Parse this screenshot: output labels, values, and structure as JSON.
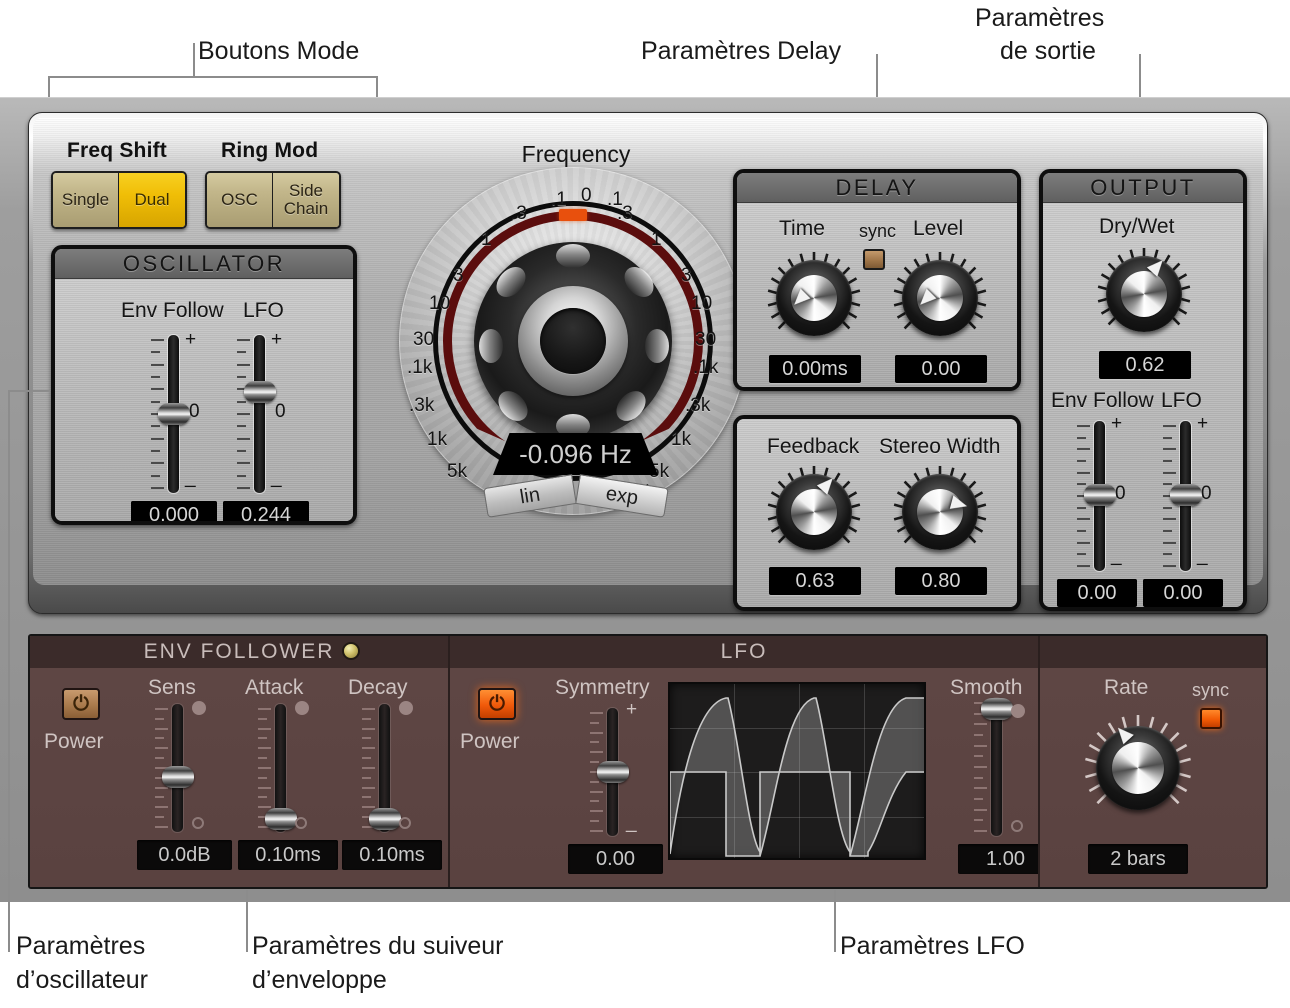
{
  "annotations": {
    "mode_buttons": "Boutons Mode",
    "delay_params": "Paramètres Delay",
    "output_params_l1": "Paramètres",
    "output_params_l2": "de sortie",
    "oscillator_params_l1": "Paramètres",
    "oscillator_params_l2": "d’oscillateur",
    "env_follower_params_l1": "Paramètres du suiveur",
    "env_follower_params_l2": "d’enveloppe",
    "lfo_params": "Paramètres LFO"
  },
  "mode": {
    "freq_shift_label": "Freq Shift",
    "ring_mod_label": "Ring Mod",
    "buttons": [
      {
        "label": "Single",
        "active": false
      },
      {
        "label": "Dual",
        "active": true
      },
      {
        "label": "OSC",
        "active": false
      },
      {
        "label": "Side\nChain",
        "active": false
      }
    ],
    "side_chain_l1": "Side",
    "side_chain_l2": "Chain"
  },
  "oscillator": {
    "title": "OSCILLATOR",
    "env_follow_label": "Env Follow",
    "lfo_label": "LFO",
    "env_follow_value": "0.000",
    "lfo_value": "0.244",
    "plus": "+",
    "minus": "_",
    "zero": "0"
  },
  "frequency": {
    "title": "Frequency",
    "readout": "-0.096 Hz",
    "lin_label": "lin",
    "exp_label": "exp",
    "minus": "–",
    "plus": "+",
    "scale_left": [
      ".3",
      "1",
      "3",
      "10",
      "30",
      ".1k",
      ".3k",
      "1k",
      "5k"
    ],
    "scale_right": [
      ".3",
      "1",
      "3",
      "10",
      "30",
      ".1k",
      ".3k",
      "1k",
      "5k"
    ],
    "scale_top": [
      ".1",
      "0",
      ".1"
    ]
  },
  "delay": {
    "title": "DELAY",
    "time_label": "Time",
    "sync_label": "sync",
    "sync_on": false,
    "level_label": "Level",
    "time_value": "0.00ms",
    "level_value": "0.00",
    "feedback_label": "Feedback",
    "stereo_width_label": "Stereo Width",
    "feedback_value": "0.63",
    "stereo_width_value": "0.80"
  },
  "output": {
    "title": "OUTPUT",
    "dry_wet_label": "Dry/Wet",
    "dry_wet_value": "0.62",
    "env_follow_label": "Env Follow",
    "lfo_label": "LFO",
    "env_follow_value": "0.00",
    "lfo_value": "0.00",
    "plus": "+",
    "minus": "_",
    "zero": "0"
  },
  "env_follower": {
    "title": "ENV FOLLOWER",
    "power_label": "Power",
    "power_on": false,
    "sens_label": "Sens",
    "attack_label": "Attack",
    "decay_label": "Decay",
    "sens_value": "0.0dB",
    "attack_value": "0.10ms",
    "decay_value": "0.10ms"
  },
  "lfo": {
    "title": "LFO",
    "power_label": "Power",
    "power_on": true,
    "symmetry_label": "Symmetry",
    "symmetry_value": "0.00",
    "smooth_label": "Smooth",
    "smooth_value": "1.00",
    "rate_label": "Rate",
    "sync_label": "sync",
    "sync_on": true,
    "rate_value": "2 bars",
    "plus": "+",
    "minus": "_"
  },
  "colors": {
    "accent_yellow": "#f0be07",
    "accent_orange": "#f0590a",
    "panel_brown": "#5a4240",
    "metal_grey": "#b4b4b4",
    "readout_black": "#000000"
  }
}
